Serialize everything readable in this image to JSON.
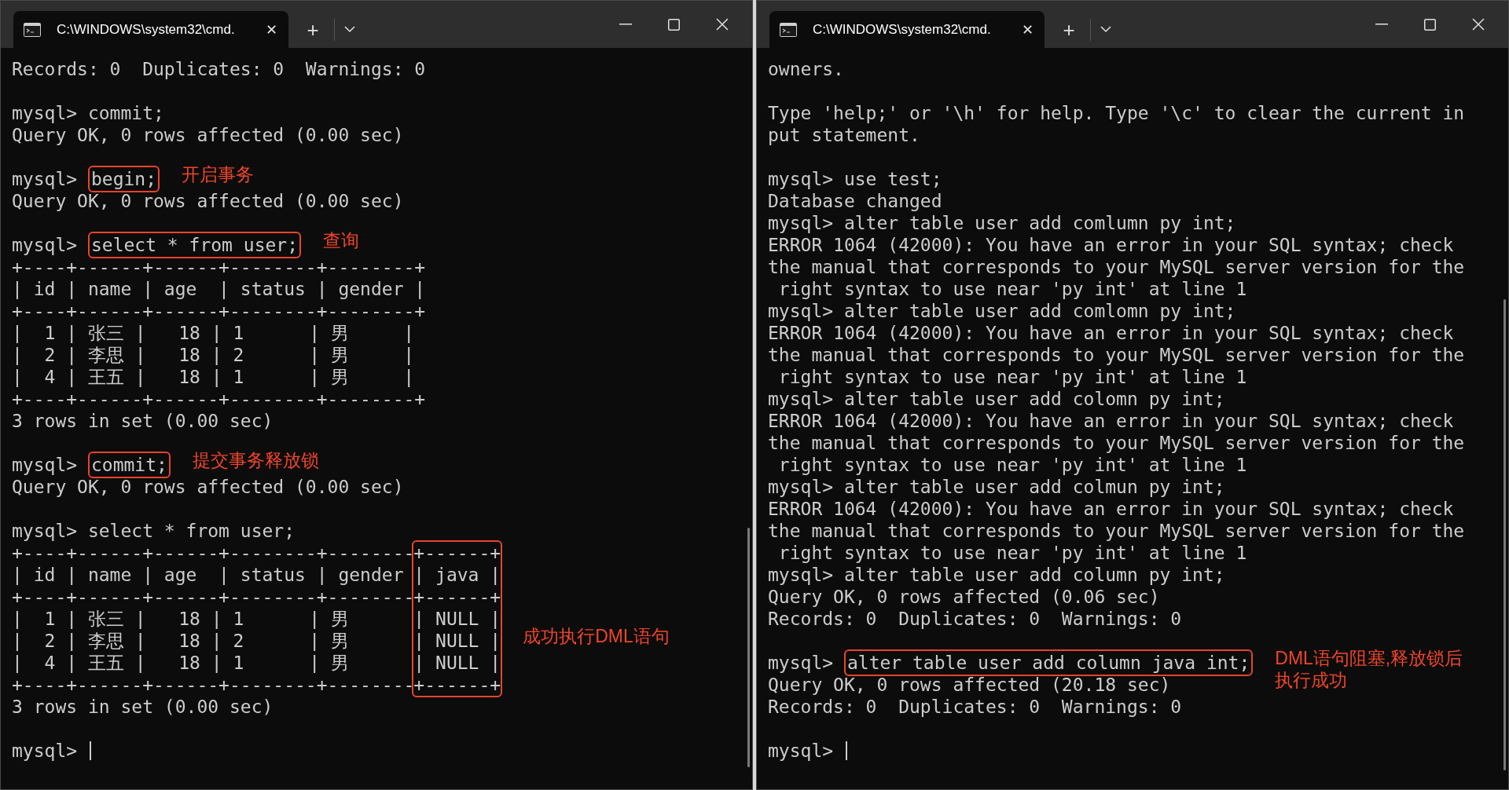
{
  "windows": [
    {
      "tab": {
        "title": "C:\\WINDOWS\\system32\\cmd.",
        "close": "✕"
      },
      "new_tab": "+",
      "lines": [
        {
          "kind": "line",
          "text": "Records: 0  Duplicates: 0  Warnings: 0"
        },
        {
          "kind": "line"
        },
        {
          "kind": "line",
          "text": "mysql> commit;"
        },
        {
          "kind": "line",
          "text": "Query OK, 0 rows affected (0.00 sec)"
        },
        {
          "kind": "line"
        },
        {
          "kind": "line",
          "text": "mysql> ",
          "boxed": "begin;",
          "note": [
            "开启事务"
          ]
        },
        {
          "kind": "line",
          "text": "Query OK, 0 rows affected (0.00 sec)"
        },
        {
          "kind": "line"
        },
        {
          "kind": "line",
          "text": "mysql> ",
          "boxed": "select * from user;",
          "note": [
            "查询"
          ]
        },
        {
          "kind": "line",
          "text": "+----+------+------+--------+--------+"
        },
        {
          "kind": "line",
          "text": "| id | name | age  | status | gender |"
        },
        {
          "kind": "line",
          "text": "+----+------+------+--------+--------+"
        },
        {
          "kind": "line",
          "text": "|  1 | 张三 |   18 | 1      | 男     |"
        },
        {
          "kind": "line",
          "text": "|  2 | 李思 |   18 | 2      | 男     |"
        },
        {
          "kind": "line",
          "text": "|  4 | 王五 |   18 | 1      | 男     |"
        },
        {
          "kind": "line",
          "text": "+----+------+------+--------+--------+"
        },
        {
          "kind": "line",
          "text": "3 rows in set (0.00 sec)"
        },
        {
          "kind": "line"
        },
        {
          "kind": "line",
          "text": "mysql> ",
          "boxed": "commit;",
          "note": [
            "提交事务释放锁"
          ]
        },
        {
          "kind": "line",
          "text": "Query OK, 0 rows affected (0.00 sec)"
        },
        {
          "kind": "line"
        },
        {
          "kind": "line",
          "text": "mysql> select * from user;"
        },
        {
          "kind": "column_box",
          "rows": [
            {
              "text": "+----+------+------+--------+--------",
              "boxed": "+------+"
            },
            {
              "text": "| id | name | age  | status | gender ",
              "boxed": "| java |"
            },
            {
              "text": "+----+------+------+--------+--------",
              "boxed": "+------+"
            },
            {
              "text": "|  1 | 张三 |   18 | 1      | 男     ",
              "boxed": "| NULL |"
            },
            {
              "text": "|  2 | 李思 |   18 | 2      | 男     ",
              "boxed": "| NULL |",
              "note": [
                "成功执行DML语句"
              ]
            },
            {
              "text": "|  4 | 王五 |   18 | 1      | 男     ",
              "boxed": "| NULL |"
            },
            {
              "text": "+----+------+------+--------+--------",
              "boxed": "+------+"
            }
          ]
        },
        {
          "kind": "line",
          "text": "3 rows in set (0.00 sec)"
        },
        {
          "kind": "line"
        },
        {
          "kind": "line",
          "text": "mysql> ",
          "cursor": true
        }
      ]
    },
    {
      "tab": {
        "title": "C:\\WINDOWS\\system32\\cmd.",
        "close": "✕"
      },
      "new_tab": "+",
      "lines": [
        {
          "kind": "line",
          "text": "owners."
        },
        {
          "kind": "line"
        },
        {
          "kind": "line",
          "text": "Type 'help;' or '\\h' for help. Type '\\c' to clear the current in"
        },
        {
          "kind": "line",
          "text": "put statement."
        },
        {
          "kind": "line"
        },
        {
          "kind": "line",
          "text": "mysql> use test;"
        },
        {
          "kind": "line",
          "text": "Database changed"
        },
        {
          "kind": "line",
          "text": "mysql> alter table user add comlumn py int;"
        },
        {
          "kind": "line",
          "text": "ERROR 1064 (42000): You have an error in your SQL syntax; check"
        },
        {
          "kind": "line",
          "text": "the manual that corresponds to your MySQL server version for the"
        },
        {
          "kind": "line",
          "text": " right syntax to use near 'py int' at line 1"
        },
        {
          "kind": "line",
          "text": "mysql> alter table user add comlomn py int;"
        },
        {
          "kind": "line",
          "text": "ERROR 1064 (42000): You have an error in your SQL syntax; check"
        },
        {
          "kind": "line",
          "text": "the manual that corresponds to your MySQL server version for the"
        },
        {
          "kind": "line",
          "text": " right syntax to use near 'py int' at line 1"
        },
        {
          "kind": "line",
          "text": "mysql> alter table user add colomn py int;"
        },
        {
          "kind": "line",
          "text": "ERROR 1064 (42000): You have an error in your SQL syntax; check"
        },
        {
          "kind": "line",
          "text": "the manual that corresponds to your MySQL server version for the"
        },
        {
          "kind": "line",
          "text": " right syntax to use near 'py int' at line 1"
        },
        {
          "kind": "line",
          "text": "mysql> alter table user add colmun py int;"
        },
        {
          "kind": "line",
          "text": "ERROR 1064 (42000): You have an error in your SQL syntax; check"
        },
        {
          "kind": "line",
          "text": "the manual that corresponds to your MySQL server version for the"
        },
        {
          "kind": "line",
          "text": " right syntax to use near 'py int' at line 1"
        },
        {
          "kind": "line",
          "text": "mysql> alter table user add column py int;"
        },
        {
          "kind": "line",
          "text": "Query OK, 0 rows affected (0.06 sec)"
        },
        {
          "kind": "line",
          "text": "Records: 0  Duplicates: 0  Warnings: 0"
        },
        {
          "kind": "line"
        },
        {
          "kind": "line",
          "text": "mysql> ",
          "boxed": "alter table user add column java int;",
          "note": [
            "DML语句阻塞,释放锁后",
            "执行成功"
          ]
        },
        {
          "kind": "line",
          "text": "Query OK, 0 rows affected (20.18 sec)"
        },
        {
          "kind": "line",
          "text": "Records: 0  Duplicates: 0  Warnings: 0"
        },
        {
          "kind": "line"
        },
        {
          "kind": "line",
          "text": "mysql> ",
          "cursor": true
        }
      ]
    }
  ]
}
